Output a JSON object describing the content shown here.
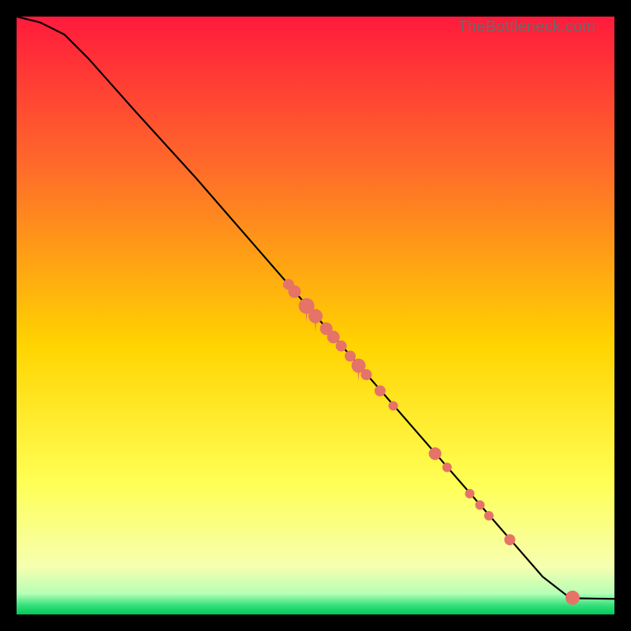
{
  "watermark": "TheBottleneck.com",
  "colors": {
    "accent_point": "#e57368",
    "line": "#000000",
    "frame": "#000000",
    "gradient_stops": [
      {
        "pct": 0,
        "color": "#ff1a3c"
      },
      {
        "pct": 25,
        "color": "#ff6a2a"
      },
      {
        "pct": 55,
        "color": "#ffd400"
      },
      {
        "pct": 78,
        "color": "#ffff55"
      },
      {
        "pct": 92,
        "color": "#f6ffb0"
      },
      {
        "pct": 96.5,
        "color": "#b6ffb6"
      },
      {
        "pct": 98.5,
        "color": "#33e07a"
      },
      {
        "pct": 100,
        "color": "#00c85a"
      }
    ]
  },
  "chart_data": {
    "type": "line",
    "title": "",
    "xlabel": "",
    "ylabel": "",
    "xlim": [
      0,
      100
    ],
    "ylim": [
      0,
      100
    ],
    "grid": false,
    "legend": false,
    "curve": [
      {
        "x": 0,
        "y": 100
      },
      {
        "x": 4,
        "y": 99
      },
      {
        "x": 8,
        "y": 97
      },
      {
        "x": 12,
        "y": 93
      },
      {
        "x": 16,
        "y": 88.5
      },
      {
        "x": 20,
        "y": 84
      },
      {
        "x": 30,
        "y": 73
      },
      {
        "x": 40,
        "y": 61.5
      },
      {
        "x": 50,
        "y": 50
      },
      {
        "x": 60,
        "y": 38.5
      },
      {
        "x": 70,
        "y": 27
      },
      {
        "x": 80,
        "y": 15.5
      },
      {
        "x": 88,
        "y": 6.3
      },
      {
        "x": 92,
        "y": 3.2
      },
      {
        "x": 93.5,
        "y": 2.7
      },
      {
        "x": 100,
        "y": 2.6
      }
    ],
    "points": [
      {
        "x": 45.5,
        "y": 55.2,
        "r": 7
      },
      {
        "x": 46.5,
        "y": 54.0,
        "r": 8
      },
      {
        "x": 48.5,
        "y": 51.6,
        "r": 10
      },
      {
        "x": 50.0,
        "y": 49.9,
        "r": 9
      },
      {
        "x": 51.8,
        "y": 47.8,
        "r": 8
      },
      {
        "x": 53.0,
        "y": 46.4,
        "r": 8
      },
      {
        "x": 54.3,
        "y": 44.9,
        "r": 7
      },
      {
        "x": 55.8,
        "y": 43.2,
        "r": 7
      },
      {
        "x": 57.2,
        "y": 41.6,
        "r": 9
      },
      {
        "x": 58.5,
        "y": 40.1,
        "r": 7
      },
      {
        "x": 60.8,
        "y": 37.4,
        "r": 7
      },
      {
        "x": 63.0,
        "y": 34.9,
        "r": 6
      },
      {
        "x": 70.0,
        "y": 26.9,
        "r": 8
      },
      {
        "x": 72.0,
        "y": 24.6,
        "r": 6
      },
      {
        "x": 75.8,
        "y": 20.2,
        "r": 6
      },
      {
        "x": 77.5,
        "y": 18.3,
        "r": 6
      },
      {
        "x": 79.0,
        "y": 16.5,
        "r": 6
      },
      {
        "x": 82.5,
        "y": 12.5,
        "r": 7
      },
      {
        "x": 93.0,
        "y": 2.8,
        "r": 9
      }
    ],
    "drip_indices": [
      2,
      3,
      8
    ]
  }
}
